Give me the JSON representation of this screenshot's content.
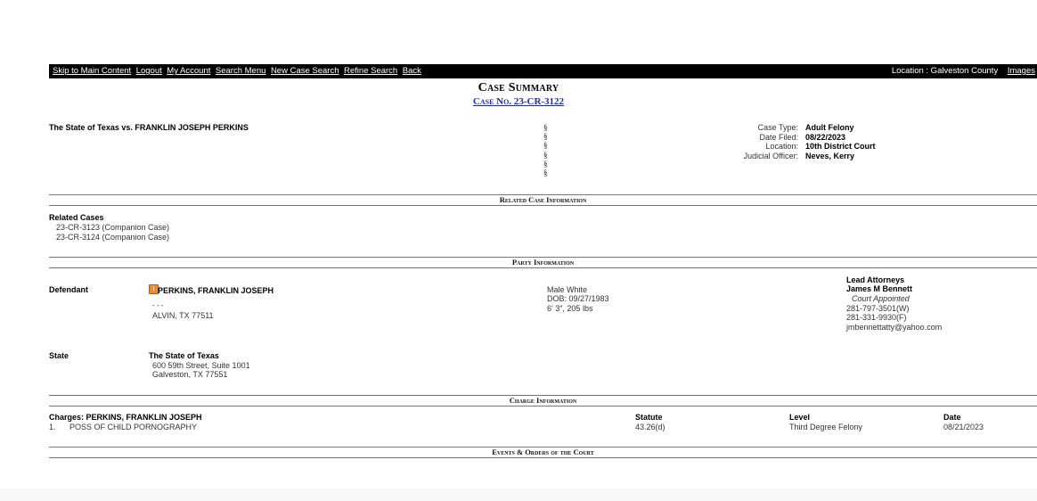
{
  "nav": {
    "links": [
      "Skip to Main Content",
      "Logout",
      "My Account",
      "Search Menu",
      "New Case Search",
      "Refine Search",
      "Back"
    ],
    "location_text": "Location : Galveston County",
    "images_link": "Images"
  },
  "title": "Case Summary",
  "case_number": "Case No. 23-CR-3122",
  "case_style": "The State of Texas vs. FRANKLIN JOSEPH PERKINS",
  "section_symbol": "§",
  "case_info": [
    {
      "label": "Case Type:",
      "value": "Adult Felony"
    },
    {
      "label": "Date Filed:",
      "value": "08/22/2023"
    },
    {
      "label": "Location:",
      "value": "10th District Court"
    },
    {
      "label": "Judicial Officer:",
      "value": "Neves, Kerry"
    }
  ],
  "sections": {
    "related": "Related Case Information",
    "party": "Party Information",
    "charge": "Charge Information",
    "events": "Events & Orders of the Court"
  },
  "related_cases": {
    "title": "Related Cases",
    "items": [
      "23-CR-3123 (Companion Case)",
      "23-CR-3124 (Companion Case)"
    ]
  },
  "defendant": {
    "label": "Defendant",
    "name": "PERKINS, FRANKLIN JOSEPH",
    "address_line1": "-                                              - -",
    "address_line2": "ALVIN, TX 77511",
    "physical": [
      "Male White",
      "DOB: 09/27/1983",
      "6' 3\", 205 lbs"
    ]
  },
  "attorney": {
    "heading": "Lead Attorneys",
    "name": "James M Bennett",
    "appointment": "Court Appointed",
    "phone_work": "281-797-3501(W)",
    "phone_fax": "281-331-9930(F)",
    "email": "jmbennettatty@yahoo.com"
  },
  "state": {
    "label": "State",
    "name": "The State of Texas",
    "address_line1": "600 59th Street, Suite 1001",
    "address_line2": "Galveston, TX 77551"
  },
  "charges": {
    "heading": "Charges: PERKINS, FRANKLIN JOSEPH",
    "col_statute": "Statute",
    "col_level": "Level",
    "col_date": "Date",
    "rows": [
      {
        "num": "1.",
        "desc": "POSS OF CHILD PORNOGRAPHY",
        "statute": "43.26(d)",
        "level": "Third Degree Felony",
        "date": "08/21/2023"
      }
    ]
  }
}
